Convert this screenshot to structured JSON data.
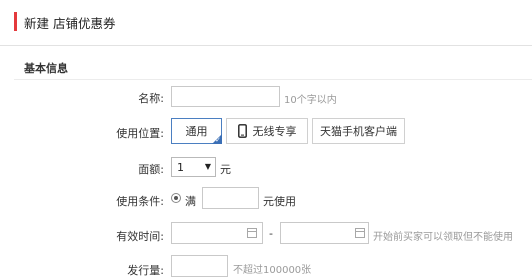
{
  "header": {
    "title": "新建 店铺优惠券",
    "accent_color": "#e4393c"
  },
  "section": {
    "title": "基本信息"
  },
  "form": {
    "name": {
      "label": "名称:",
      "value": "",
      "hint": "10个字以内"
    },
    "position": {
      "label": "使用位置:",
      "options": [
        {
          "label": "通用",
          "selected": true
        },
        {
          "label": "无线专享",
          "icon": "mobile-phone-icon"
        },
        {
          "label": "天猫手机客户端"
        }
      ]
    },
    "amount": {
      "label": "面额:",
      "selected_value": "1",
      "unit": "元"
    },
    "condition": {
      "label": "使用条件:",
      "radio_label": "满",
      "value": "",
      "suffix": "元使用"
    },
    "validity": {
      "label": "有效时间:",
      "separator": "-",
      "hint": "开始前买家可以领取但不能使用"
    },
    "quantity": {
      "label": "发行量:",
      "value": "",
      "hint": "不超过100000张"
    }
  }
}
